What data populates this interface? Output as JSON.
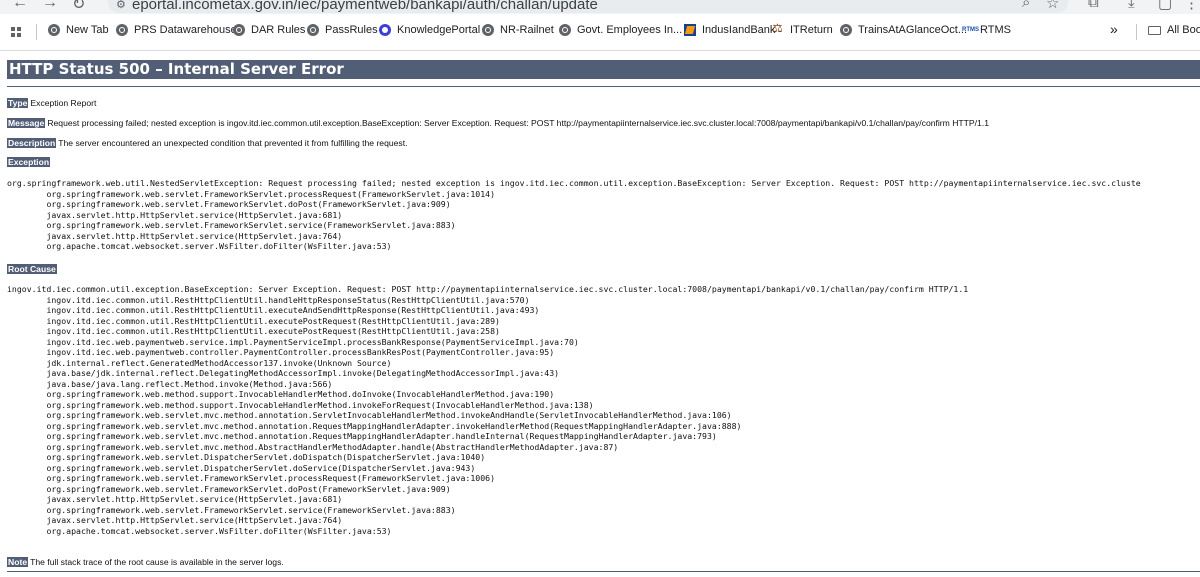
{
  "browser": {
    "url": "eportal.incometax.gov.in/iec/paymentweb/bankapi/auth/challan/update",
    "bookmarks": [
      {
        "label": "New Tab",
        "icon": "globe-icon"
      },
      {
        "label": "PRS Datawarehouse",
        "icon": "globe-icon"
      },
      {
        "label": "DAR Rules",
        "icon": "globe-icon"
      },
      {
        "label": "PassRules",
        "icon": "globe-icon"
      },
      {
        "label": "KnowledgePortal",
        "icon": "knowledge-portal-icon"
      },
      {
        "label": "NR-Railnet",
        "icon": "globe-icon"
      },
      {
        "label": "Govt. Employees In...",
        "icon": "globe-icon"
      },
      {
        "label": "IndusIandBank",
        "icon": "indusind-icon"
      },
      {
        "label": "ITReturn",
        "icon": "itreturn-icon"
      },
      {
        "label": "TrainsAtAGlanceOct...",
        "icon": "globe-icon"
      },
      {
        "label": "RTMS",
        "icon": "rtms-icon"
      }
    ],
    "rtms_icon_text": "RTMS",
    "overflow_chevron": "»",
    "all_bookmarks": "All Bookmarks"
  },
  "error": {
    "title": "HTTP Status 500 – Internal Server Error",
    "type_label": "Type",
    "type_value": "Exception Report",
    "message_label": "Message",
    "message_value": "Request processing failed; nested exception is ingov.itd.iec.common.util.exception.BaseException: Server Exception. Request: POST http://paymentapiinternalservice.iec.svc.cluster.local:7008/paymentapi/bankapi/v0.1/challan/pay/confirm HTTP/1.1",
    "description_label": "Description",
    "description_value": "The server encountered an unexpected condition that prevented it from fulfilling the request.",
    "exception_label": "Exception",
    "exception_trace": "org.springframework.web.util.NestedServletException: Request processing failed; nested exception is ingov.itd.iec.common.util.exception.BaseException: Server Exception. Request: POST http://paymentapiinternalservice.iec.svc.cluste\n\torg.springframework.web.servlet.FrameworkServlet.processRequest(FrameworkServlet.java:1014)\n\torg.springframework.web.servlet.FrameworkServlet.doPost(FrameworkServlet.java:909)\n\tjavax.servlet.http.HttpServlet.service(HttpServlet.java:681)\n\torg.springframework.web.servlet.FrameworkServlet.service(FrameworkServlet.java:883)\n\tjavax.servlet.http.HttpServlet.service(HttpServlet.java:764)\n\torg.apache.tomcat.websocket.server.WsFilter.doFilter(WsFilter.java:53)",
    "root_cause_label": "Root Cause",
    "root_cause_trace": "ingov.itd.iec.common.util.exception.BaseException: Server Exception. Request: POST http://paymentapiinternalservice.iec.svc.cluster.local:7008/paymentapi/bankapi/v0.1/challan/pay/confirm HTTP/1.1\n\tingov.itd.iec.common.util.RestHttpClientUtil.handleHttpResponseStatus(RestHttpClientUtil.java:570)\n\tingov.itd.iec.common.util.RestHttpClientUtil.executeAndSendHttpResponse(RestHttpClientUtil.java:493)\n\tingov.itd.iec.common.util.RestHttpClientUtil.executePostRequest(RestHttpClientUtil.java:289)\n\tingov.itd.iec.common.util.RestHttpClientUtil.executePostRequest(RestHttpClientUtil.java:258)\n\tingov.itd.iec.web.paymentweb.service.impl.PaymentServiceImpl.processBankResponse(PaymentServiceImpl.java:70)\n\tingov.itd.iec.web.paymentweb.controller.PaymentController.processBankResPost(PaymentController.java:95)\n\tjdk.internal.reflect.GeneratedMethodAccessor137.invoke(Unknown Source)\n\tjava.base/jdk.internal.reflect.DelegatingMethodAccessorImpl.invoke(DelegatingMethodAccessorImpl.java:43)\n\tjava.base/java.lang.reflect.Method.invoke(Method.java:566)\n\torg.springframework.web.method.support.InvocableHandlerMethod.doInvoke(InvocableHandlerMethod.java:190)\n\torg.springframework.web.method.support.InvocableHandlerMethod.invokeForRequest(InvocableHandlerMethod.java:138)\n\torg.springframework.web.servlet.mvc.method.annotation.ServletInvocableHandlerMethod.invokeAndHandle(ServletInvocableHandlerMethod.java:106)\n\torg.springframework.web.servlet.mvc.method.annotation.RequestMappingHandlerAdapter.invokeHandlerMethod(RequestMappingHandlerAdapter.java:888)\n\torg.springframework.web.servlet.mvc.method.annotation.RequestMappingHandlerAdapter.handleInternal(RequestMappingHandlerAdapter.java:793)\n\torg.springframework.web.servlet.mvc.method.AbstractHandlerMethodAdapter.handle(AbstractHandlerMethodAdapter.java:87)\n\torg.springframework.web.servlet.DispatcherServlet.doDispatch(DispatcherServlet.java:1040)\n\torg.springframework.web.servlet.DispatcherServlet.doService(DispatcherServlet.java:943)\n\torg.springframework.web.servlet.FrameworkServlet.processRequest(FrameworkServlet.java:1006)\n\torg.springframework.web.servlet.FrameworkServlet.doPost(FrameworkServlet.java:909)\n\tjavax.servlet.http.HttpServlet.service(HttpServlet.java:681)\n\torg.springframework.web.servlet.FrameworkServlet.service(FrameworkServlet.java:883)\n\tjavax.servlet.http.HttpServlet.service(HttpServlet.java:764)\n\torg.apache.tomcat.websocket.server.WsFilter.doFilter(WsFilter.java:53)",
    "note_label": "Note",
    "note_value": "The full stack trace of the root cause is available in the server logs."
  }
}
